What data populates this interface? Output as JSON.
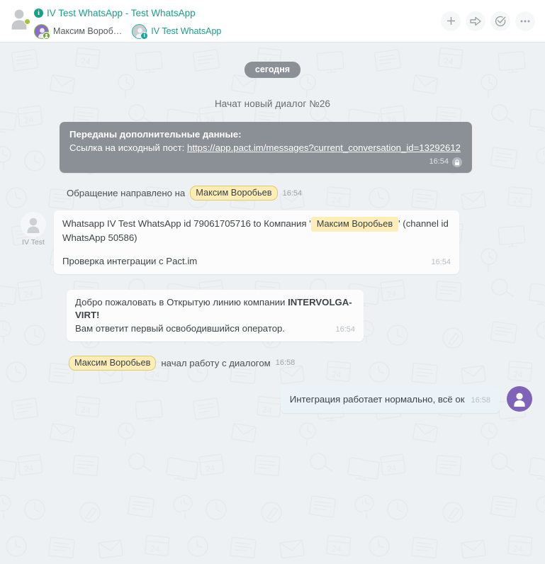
{
  "header": {
    "conversation_title": "IV Test WhatsApp - Test WhatsApp",
    "info_icon_glyph": "i",
    "participants": [
      {
        "name": "Максим Вороб…",
        "icon": "user-purple-avatar-icon",
        "badge": "badge-green-user-icon",
        "badge_glyph": ""
      },
      {
        "name": "IV Test WhatsApp",
        "icon": "user-gray-avatar-icon",
        "badge": "badge-teal-info-icon",
        "badge_glyph": "i"
      }
    ],
    "actions": [
      {
        "name": "add-button",
        "icon": "plus-icon"
      },
      {
        "name": "forward-button",
        "icon": "arrow-right-icon"
      },
      {
        "name": "resolve-button",
        "icon": "check-circle-icon"
      },
      {
        "name": "more-button",
        "icon": "ellipsis-icon"
      }
    ]
  },
  "chat": {
    "day_divider": "сегодня",
    "system_new_dialog": "Начат новый диалог №26",
    "extra_data": {
      "title": "Переданы дополнительные данные:",
      "link_label": "Ссылка на исходный пост:",
      "link_url": "https://app.pact.im/messages?current_conversation_id=13292612",
      "time": "16:54",
      "lock_icon": "lock-icon"
    },
    "assigned": {
      "prefix": "Обращение направлено на",
      "operator": "Максим Воробьев",
      "time": "16:54"
    },
    "incoming_info": {
      "avatar_label": "IV Test",
      "line1_before": "Whatsapp IV Test WhatsApp id 79061705716 to Компания '",
      "line1_chip": "Максим Воробьев",
      "line1_after": "' (channel id WhatsApp 50586)",
      "line2": "Проверка интеграции с Pact.im",
      "time": "16:54"
    },
    "greeting": {
      "line1_before": "Добро пожаловать в Открытую линию компании ",
      "line1_bold": "INTERVOLGA-VIRT!",
      "line2": "Вам ответит первый освободившийся оператор.",
      "time": "16:54"
    },
    "started": {
      "operator": "Максим Воробьев",
      "text": "начал работу с диалогом",
      "time": "16:58"
    },
    "outgoing": {
      "text": "Интеграция работает нормально, всё ок",
      "time": "16:58",
      "avatar": "operator-avatar-icon"
    }
  },
  "colors": {
    "background": "#eef1f3",
    "accent_teal": "#1a9e8c",
    "system_bubble": "#8a9096",
    "name_chip": "#fdeeb7",
    "outgoing_bubble": "#eaf3f7",
    "operator_avatar": "#7e63b8",
    "status_dot": "#a6c43a"
  }
}
